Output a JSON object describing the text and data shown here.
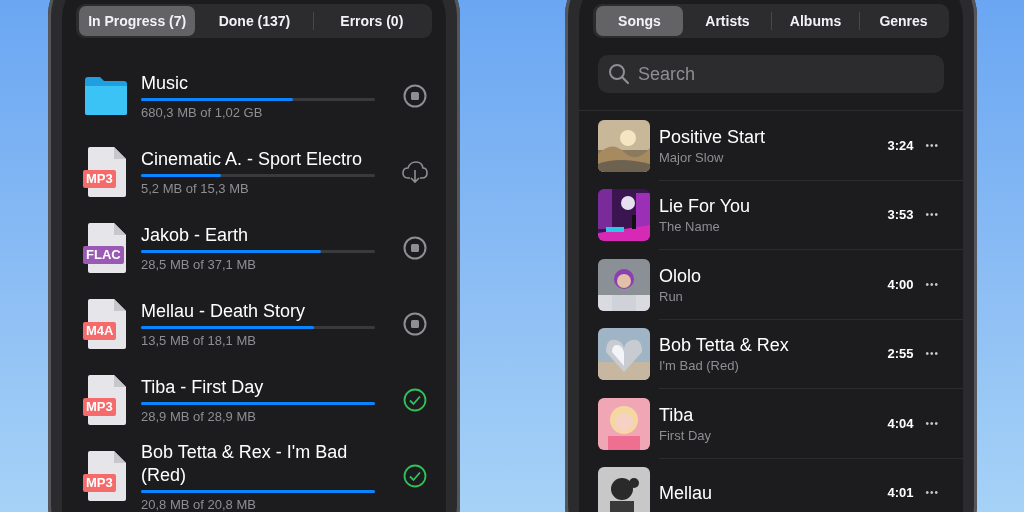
{
  "downloads": {
    "tabs": [
      {
        "label": "In Progress (7)",
        "selected": true
      },
      {
        "label": "Done (137)",
        "selected": false
      },
      {
        "label": "Errors (0)",
        "selected": false
      }
    ],
    "items": [
      {
        "kind": "folder",
        "title": "Music",
        "level": 0.65,
        "size": "680,3 MB of 1,02 GB",
        "action": {
          "kind": "stop"
        }
      },
      {
        "kind": "file",
        "format": "MP3",
        "color": "#f56b6b",
        "title": "Cinematic A. - Sport Electro",
        "level": 0.34,
        "size": "5,2 MB of 15,3 MB",
        "action": {
          "kind": "download"
        }
      },
      {
        "kind": "file",
        "format": "FLAC",
        "color": "#9b59b6",
        "title": "Jakob - Earth",
        "level": 0.77,
        "size": "28,5 MB of 37,1 MB",
        "action": {
          "kind": "stop"
        }
      },
      {
        "kind": "file",
        "format": "M4A",
        "color": "#f56b6b",
        "title": "Mellau - Death Story",
        "level": 0.74,
        "size": "13,5 MB of 18,1 MB",
        "action": {
          "kind": "stop"
        }
      },
      {
        "kind": "file",
        "format": "MP3",
        "color": "#f56b6b",
        "title": "Tiba - First Day",
        "level": 1,
        "size": "28,9 MB of 28,9 MB",
        "action": {
          "kind": "done"
        }
      },
      {
        "kind": "file",
        "format": "MP3",
        "color": "#f56b6b",
        "title": "Bob Tetta & Rex - I'm Bad (Red)",
        "level": 1,
        "size": "20,8 MB of 20,8 MB",
        "action": {
          "kind": "done"
        }
      }
    ]
  },
  "library": {
    "tabs": [
      {
        "label": "Songs",
        "selected": true
      },
      {
        "label": "Artists",
        "selected": false
      },
      {
        "label": "Albums",
        "selected": false
      },
      {
        "label": "Genres",
        "selected": false
      }
    ],
    "search": {
      "placeholder": "Search"
    },
    "songs": [
      {
        "title": "Positive Start",
        "artist": "Major Slow",
        "duration": "3:24",
        "more": "•••"
      },
      {
        "title": "Lie For You",
        "artist": "The Name",
        "duration": "3:53",
        "more": "•••"
      },
      {
        "title": "Ololo",
        "artist": "Run",
        "duration": "4:00",
        "more": "•••"
      },
      {
        "title": "Bob Tetta & Rex",
        "artist": "I'm Bad (Red)",
        "duration": "2:55",
        "more": "•••"
      },
      {
        "title": "Tiba",
        "artist": "First Day",
        "duration": "4:04",
        "more": "•••"
      },
      {
        "title": "Mellau",
        "duration": "4:01",
        "more": "•••"
      }
    ]
  }
}
